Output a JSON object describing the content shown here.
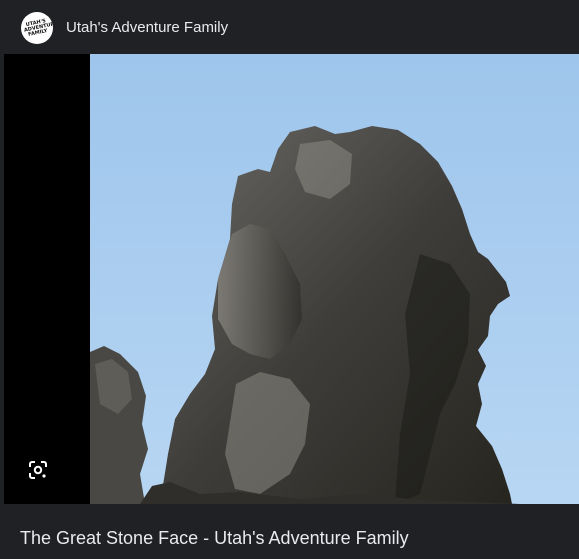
{
  "header": {
    "site_name": "Utah's Adventure Family",
    "logo_text": "UTAH'S ADVENTURE FAMILY",
    "logo_icon": "site-logo"
  },
  "image": {
    "subject": "rock-formation",
    "lens_icon": "lens-search-icon"
  },
  "caption": {
    "title": "The Great Stone Face - Utah's Adventure Family"
  },
  "colors": {
    "background": "#202124",
    "text": "#e8eaed",
    "sky": "#a9cdf0",
    "letterbox": "#000000"
  }
}
